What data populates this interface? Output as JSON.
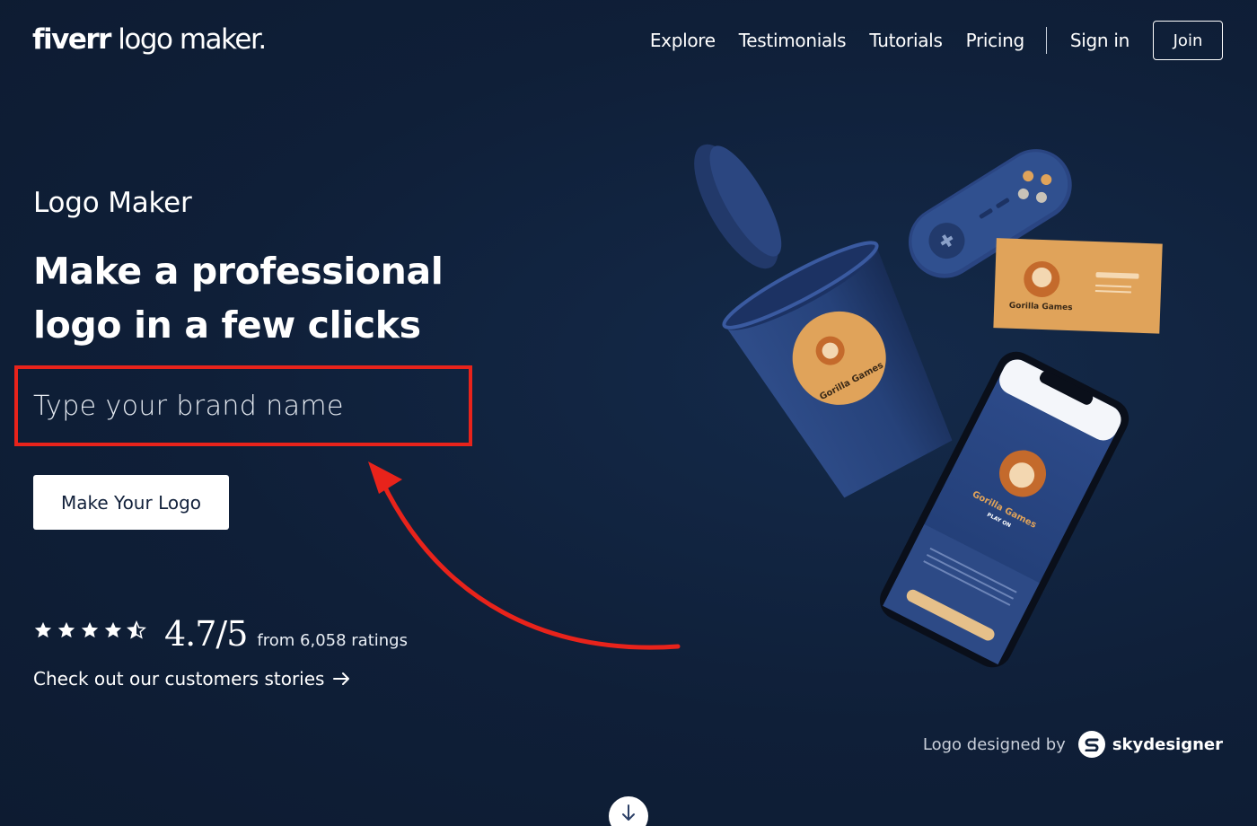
{
  "header": {
    "logo_bold": "fiverr",
    "logo_light": " logo maker.",
    "nav": {
      "explore": "Explore",
      "testimonials": "Testimonials",
      "tutorials": "Tutorials",
      "pricing": "Pricing",
      "sign_in": "Sign in",
      "join": "Join"
    }
  },
  "hero": {
    "eyebrow": "Logo Maker",
    "headline": "Make a professional logo in a few clicks",
    "input_placeholder": "Type your brand name",
    "cta": "Make Your Logo",
    "rating": {
      "stars_value": 4.5,
      "stars_max": 5,
      "score": "4.7/5",
      "count_text": "from 6,058 ratings"
    },
    "stories_link": "Check out our customers stories"
  },
  "mockup": {
    "brand_name": "Gorilla Games",
    "tagline": "PLAY ON"
  },
  "credit": {
    "prefix": "Logo designed by",
    "designer": "skydesigner"
  },
  "colors": {
    "background": "#0f1f38",
    "annotation_red": "#e8231b",
    "mockup_blue": "#26427a",
    "mockup_orange": "#e0a35a"
  },
  "icons": [
    "star-icon",
    "half-star-icon",
    "arrow-right-icon",
    "arrow-down-icon",
    "annotation-arrow-icon"
  ]
}
